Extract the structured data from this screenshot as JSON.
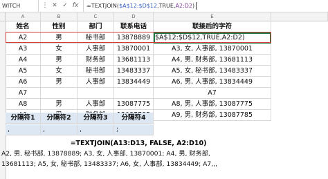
{
  "formula_bar": {
    "name_box": "WITCH",
    "buttons": [
      "⋮",
      "✕",
      "✓",
      "fx"
    ],
    "formula_parts": [
      {
        "text": "=TEXTJOIN(",
        "color": "default"
      },
      {
        "text": "$A$12:$D$12",
        "color": "blue"
      },
      {
        "text": ",TRUE,",
        "color": "default"
      },
      {
        "text": "A2:D2",
        "color": "purple"
      },
      {
        "text": ")",
        "color": "default"
      }
    ]
  },
  "columns": [
    "A",
    "B",
    "C",
    "D",
    "E"
  ],
  "table": {
    "headers": [
      "姓名",
      "性别",
      "部门",
      "联系电话",
      "联接后的字符"
    ],
    "rows": [
      [
        "A2",
        "男",
        "秘书部",
        "13878889",
        "$A$12:$D$12,TRUE,A2:D2)"
      ],
      [
        "A3",
        "女",
        "人事部",
        "13870001",
        "A3, 女, 人事部, 13870001"
      ],
      [
        "A4",
        "男",
        "财务部",
        "13681113",
        "A4, 男, 财务部, 13681113"
      ],
      [
        "A5",
        "女",
        "秘书部",
        "13483337",
        "A5, 女, 秘书部, 13483337"
      ],
      [
        "A6",
        "男",
        "人事部",
        "13834449",
        "A6, 男, 人事部, 13834449"
      ],
      [
        "A7",
        "",
        "",
        "",
        "A7"
      ],
      [
        "A8",
        "男",
        "人事部",
        "13087775",
        "A8, 男, 人事部, 13087775"
      ],
      [
        "A9",
        "男",
        "财务部",
        "13087785",
        "A9, 男, 财务部, 13087785"
      ]
    ]
  },
  "separators": {
    "headers": [
      "分隔符1",
      "分隔符2",
      "分隔符3",
      "分隔符4"
    ],
    "values": [
      ",",
      ",",
      ",",
      ";"
    ]
  },
  "textjoin_formula": "=TEXTJOIN(A13:D13, FALSE, A2:D10)",
  "result_lines": [
    "A2, 男, 秘书部, 13878889; A3, 女, 人事部, 13870001; A4, 男, 财务部,",
    "13681113; A5, 女, 秘书部, 13483337; A6, 女, 人事部, 13834449; A7,,,"
  ]
}
